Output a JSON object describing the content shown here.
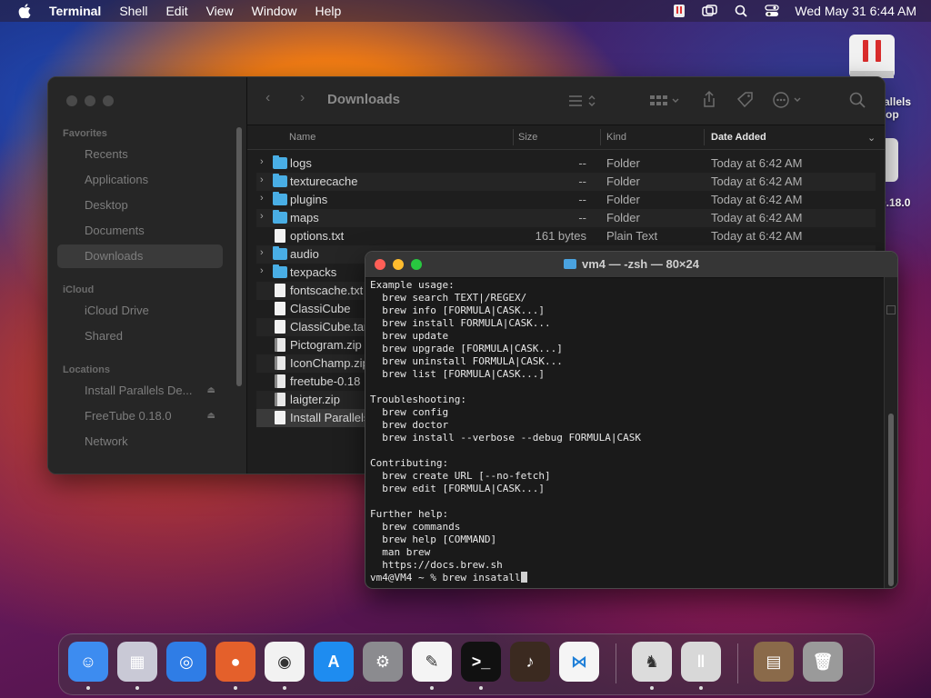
{
  "menubar": {
    "app_name": "Terminal",
    "items": [
      "Shell",
      "Edit",
      "View",
      "Window",
      "Help"
    ],
    "clock": "Wed May 31  6:44 AM"
  },
  "desktop": {
    "parallels_label_1": "allels",
    "parallels_label_2": "op",
    "freetube_label": "0.18.0"
  },
  "finder": {
    "title": "Downloads",
    "sidebar": {
      "favorites_header": "Favorites",
      "favorites": [
        "Recents",
        "Applications",
        "Desktop",
        "Documents",
        "Downloads"
      ],
      "icloud_header": "iCloud",
      "icloud": [
        "iCloud Drive",
        "Shared"
      ],
      "locations_header": "Locations",
      "locations": [
        "Install Parallels De...",
        "FreeTube 0.18.0",
        "Network"
      ]
    },
    "columns": {
      "name": "Name",
      "size": "Size",
      "kind": "Kind",
      "date": "Date Added"
    },
    "rows": [
      {
        "name": "logs",
        "size": "--",
        "kind": "Folder",
        "date": "Today at 6:42 AM",
        "type": "folder"
      },
      {
        "name": "texturecache",
        "size": "--",
        "kind": "Folder",
        "date": "Today at 6:42 AM",
        "type": "folder"
      },
      {
        "name": "plugins",
        "size": "--",
        "kind": "Folder",
        "date": "Today at 6:42 AM",
        "type": "folder"
      },
      {
        "name": "maps",
        "size": "--",
        "kind": "Folder",
        "date": "Today at 6:42 AM",
        "type": "folder"
      },
      {
        "name": "options.txt",
        "size": "161 bytes",
        "kind": "Plain Text",
        "date": "Today at 6:42 AM",
        "type": "doc"
      },
      {
        "name": "audio",
        "size": "",
        "kind": "",
        "date": "",
        "type": "folder"
      },
      {
        "name": "texpacks",
        "size": "",
        "kind": "",
        "date": "",
        "type": "folder"
      },
      {
        "name": "fontscache.txt",
        "size": "",
        "kind": "",
        "date": "",
        "type": "doc"
      },
      {
        "name": "ClassiCube",
        "size": "",
        "kind": "",
        "date": "",
        "type": "doc"
      },
      {
        "name": "ClassiCube.tar",
        "size": "",
        "kind": "",
        "date": "",
        "type": "doc"
      },
      {
        "name": "Pictogram.zip",
        "size": "",
        "kind": "",
        "date": "",
        "type": "zip"
      },
      {
        "name": "IconChamp.zip",
        "size": "",
        "kind": "",
        "date": "",
        "type": "zip"
      },
      {
        "name": "freetube-0.18",
        "size": "",
        "kind": "",
        "date": "",
        "type": "zip"
      },
      {
        "name": "laigter.zip",
        "size": "",
        "kind": "",
        "date": "",
        "type": "zip"
      },
      {
        "name": "Install Parallels",
        "size": "",
        "kind": "",
        "date": "",
        "type": "doc"
      }
    ]
  },
  "terminal": {
    "title": "vm4 — -zsh — 80×24",
    "lines": [
      "Example usage:",
      "  brew search TEXT|/REGEX/",
      "  brew info [FORMULA|CASK...]",
      "  brew install FORMULA|CASK...",
      "  brew update",
      "  brew upgrade [FORMULA|CASK...]",
      "  brew uninstall FORMULA|CASK...",
      "  brew list [FORMULA|CASK...]",
      "",
      "Troubleshooting:",
      "  brew config",
      "  brew doctor",
      "  brew install --verbose --debug FORMULA|CASK",
      "",
      "Contributing:",
      "  brew create URL [--no-fetch]",
      "  brew edit [FORMULA|CASK...]",
      "",
      "Further help:",
      "  brew commands",
      "  brew help [COMMAND]",
      "  man brew",
      "  https://docs.brew.sh"
    ],
    "prompt": "vm4@VM4 ~ % brew insatall"
  },
  "dock": {
    "apps": [
      {
        "name": "finder-app",
        "color": "#3d8cf0",
        "glyph": "☺"
      },
      {
        "name": "launchpad-app",
        "color": "#c9c9d6",
        "glyph": "▦"
      },
      {
        "name": "safari-app",
        "color": "#2f7de6",
        "glyph": "◎"
      },
      {
        "name": "firefox-app",
        "color": "#e4602b",
        "glyph": "●"
      },
      {
        "name": "chrome-app",
        "color": "#f2f2f2",
        "glyph": "◉"
      },
      {
        "name": "app-store-app",
        "color": "#1e8cf0",
        "glyph": "A"
      },
      {
        "name": "system-preferences-app",
        "color": "#8b8b8f",
        "glyph": "⚙"
      },
      {
        "name": "textedit-app",
        "color": "#f4f4f4",
        "glyph": "✎"
      },
      {
        "name": "terminal-app",
        "color": "#111111",
        "glyph": ">_"
      },
      {
        "name": "garageband-app",
        "color": "#3b2a20",
        "glyph": "♪"
      },
      {
        "name": "vscode-app",
        "color": "#f5f5f5",
        "glyph": "⋈"
      },
      {
        "name": "chess-app",
        "color": "#dcdcdc",
        "glyph": "♞"
      },
      {
        "name": "parallels-app",
        "color": "#d8d8d8",
        "glyph": "‖"
      },
      {
        "name": "downloads-stack",
        "color": "#8a6a4a",
        "glyph": "▤"
      },
      {
        "name": "trash",
        "color": "#9a9a9a",
        "glyph": "🗑"
      }
    ]
  }
}
